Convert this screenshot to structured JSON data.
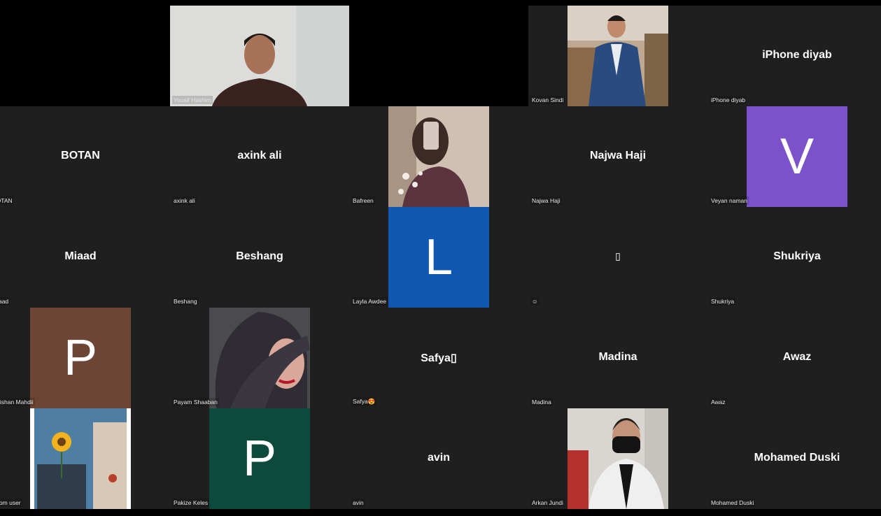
{
  "participants": [
    {
      "id": "yousif",
      "label": "Yousif Hashim"
    },
    {
      "id": "kovan",
      "label": "Kovan Sindi"
    },
    {
      "id": "iphone",
      "big": "iPhone diyab",
      "label": "iPhone diyab"
    },
    {
      "id": "botan",
      "big": "BOTAN",
      "label": "BOTAN"
    },
    {
      "id": "axink",
      "big": "axink ali",
      "label": "axink ali"
    },
    {
      "id": "bafreen",
      "label": "Bafreen"
    },
    {
      "id": "najwa",
      "big": "Najwa Haji",
      "label": "Najwa Haji"
    },
    {
      "id": "veyan",
      "avatar_letter": "V",
      "label": "Veyan naman",
      "color": "#7b52c9"
    },
    {
      "id": "miaad",
      "big": "Miaad",
      "label": "Miaad"
    },
    {
      "id": "beshang",
      "big": "Beshang",
      "label": "Beshang"
    },
    {
      "id": "layla",
      "avatar_letter": "L",
      "label": "Layla Awdee",
      "color": "#0f57b0"
    },
    {
      "id": "emoji",
      "big": "▯",
      "label": "☺"
    },
    {
      "id": "shukriya",
      "big": "Shukriya",
      "label": "Shukriya"
    },
    {
      "id": "nirishan",
      "avatar_letter": "P",
      "label": "Nirishan Mahdii",
      "color": "#6d4534"
    },
    {
      "id": "payam",
      "label": "Payam Shaaban"
    },
    {
      "id": "safya",
      "big": "Safya▯",
      "label": "Safya😍"
    },
    {
      "id": "madina",
      "big": "Madina",
      "label": "Madina"
    },
    {
      "id": "awaz",
      "big": "Awaz",
      "label": "Awaz"
    },
    {
      "id": "zoom",
      "label": "Zoom user"
    },
    {
      "id": "pakize",
      "avatar_letter": "P",
      "label": "Pakize Keles",
      "color": "#0c4a3c"
    },
    {
      "id": "avin",
      "big": "avin",
      "label": "avin"
    },
    {
      "id": "arkan",
      "label": "Arkan Jundi"
    },
    {
      "id": "mohamed",
      "big": "Mohamed Duski",
      "label": "Mohamed Duski"
    }
  ]
}
